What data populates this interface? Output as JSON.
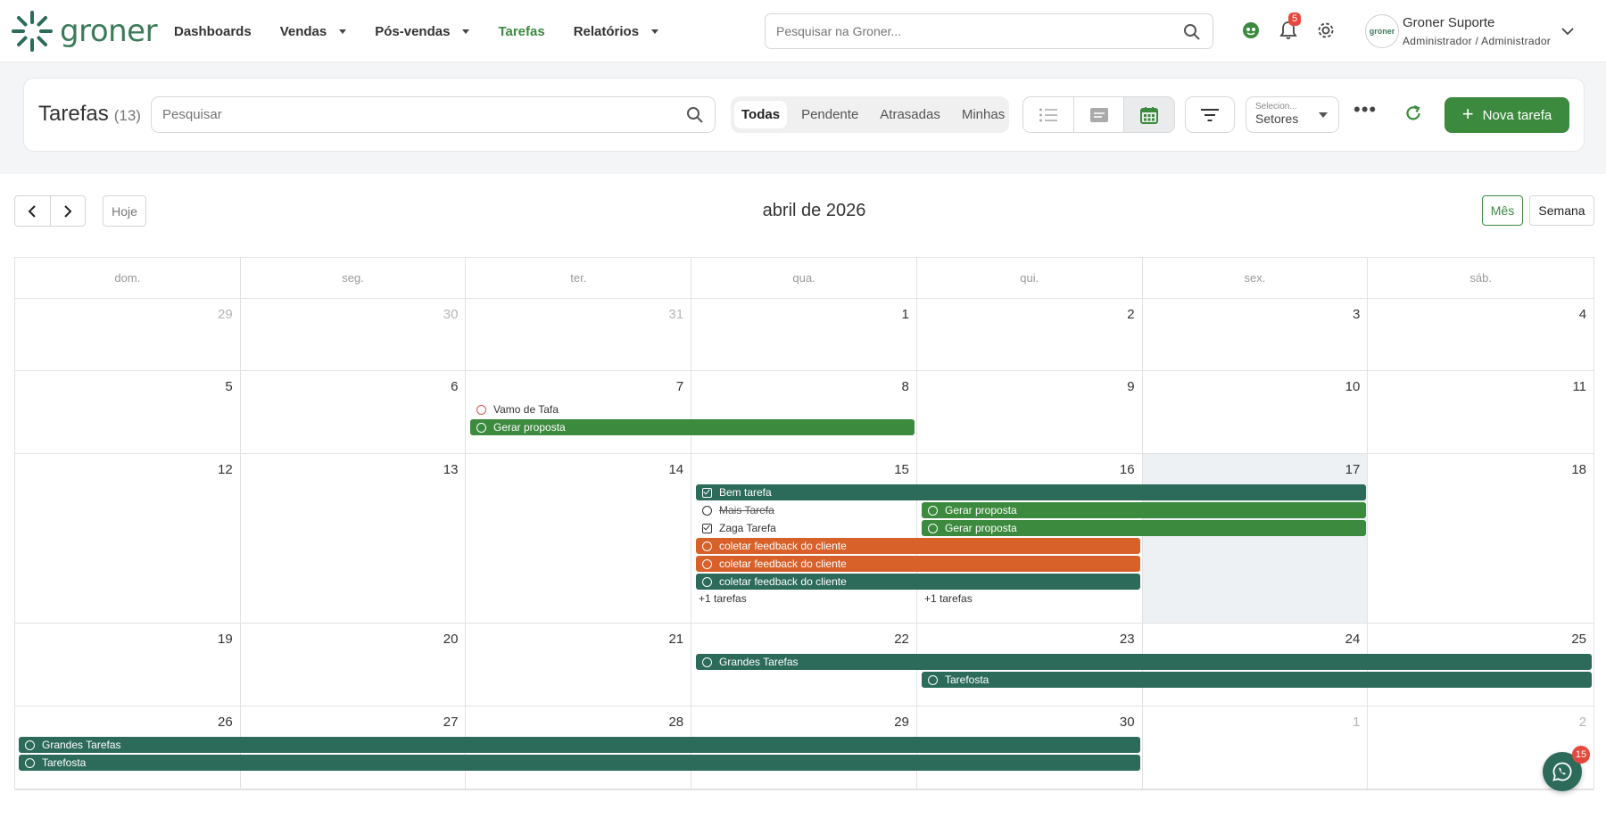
{
  "nav": {
    "brand": "groner",
    "links": [
      {
        "label": "Dashboards",
        "dropdown": false,
        "active": false
      },
      {
        "label": "Vendas",
        "dropdown": true,
        "active": false
      },
      {
        "label": "Pós-vendas",
        "dropdown": true,
        "active": false
      },
      {
        "label": "Tarefas",
        "dropdown": false,
        "active": true
      },
      {
        "label": "Relatórios",
        "dropdown": true,
        "active": false
      }
    ],
    "search_placeholder": "Pesquisar na Groner...",
    "notifications_count": "5",
    "user": {
      "name": "Groner Suporte",
      "role": "Administrador / Administrador",
      "avatar_text": "groner"
    }
  },
  "toolbar": {
    "title": "Tarefas",
    "count": "(13)",
    "search_placeholder": "Pesquisar",
    "filters": [
      "Todas",
      "Pendente",
      "Atrasadas",
      "Minhas"
    ],
    "active_filter": "Todas",
    "views": [
      "list-icon",
      "card-icon",
      "calendar-icon"
    ],
    "active_view": "calendar",
    "sector_hint": "Selecion...",
    "sector_value": "Setores",
    "new_task_label": "Nova tarefa"
  },
  "calendar": {
    "title": "abril de 2026",
    "today_label": "Hoje",
    "view_month": "Mês",
    "view_week": "Semana",
    "active_view": "Mês",
    "weekdays": [
      "dom.",
      "seg.",
      "ter.",
      "qua.",
      "qui.",
      "sex.",
      "sáb."
    ],
    "weeks": [
      [
        "29",
        "30",
        "31",
        "1",
        "2",
        "3",
        "4"
      ],
      [
        "5",
        "6",
        "7",
        "8",
        "9",
        "10",
        "11"
      ],
      [
        "12",
        "13",
        "14",
        "15",
        "16",
        "17",
        "18"
      ],
      [
        "19",
        "20",
        "21",
        "22",
        "23",
        "24",
        "25"
      ],
      [
        "26",
        "27",
        "28",
        "29",
        "30",
        "1",
        "2"
      ]
    ],
    "other_month_cells": [
      [
        0,
        0
      ],
      [
        0,
        1
      ],
      [
        0,
        2
      ],
      [
        4,
        5
      ],
      [
        4,
        6
      ]
    ],
    "today_cell": [
      2,
      5
    ],
    "events": [
      {
        "label": "Vamo de Tafa",
        "week": 1,
        "start": 2,
        "span": 1,
        "lane": 0,
        "style": "plain",
        "icon": "circle",
        "circle_color": "red"
      },
      {
        "label": "Gerar proposta",
        "week": 1,
        "start": 2,
        "span": 2,
        "lane": 1,
        "style": "green",
        "icon": "circle"
      },
      {
        "label": "Bem tarefa",
        "week": 2,
        "start": 3,
        "span": 3,
        "lane": 0,
        "style": "teal",
        "icon": "check"
      },
      {
        "label": "Mais Tarefa",
        "week": 2,
        "start": 3,
        "span": 1,
        "lane": 1,
        "style": "plain",
        "icon": "circle",
        "strike": true
      },
      {
        "label": "Gerar proposta",
        "week": 2,
        "start": 4,
        "span": 2,
        "lane": 1,
        "style": "green",
        "icon": "circle"
      },
      {
        "label": "Zaga Tarefa",
        "week": 2,
        "start": 3,
        "span": 1,
        "lane": 2,
        "style": "plain",
        "icon": "check"
      },
      {
        "label": "Gerar proposta",
        "week": 2,
        "start": 4,
        "span": 2,
        "lane": 2,
        "style": "green",
        "icon": "circle"
      },
      {
        "label": "coletar feedback do cliente",
        "week": 2,
        "start": 3,
        "span": 2,
        "lane": 3,
        "style": "orange",
        "icon": "circle"
      },
      {
        "label": "coletar feedback do cliente",
        "week": 2,
        "start": 3,
        "span": 2,
        "lane": 4,
        "style": "orange",
        "icon": "circle"
      },
      {
        "label": "coletar feedback do cliente",
        "week": 2,
        "start": 3,
        "span": 2,
        "lane": 5,
        "style": "teal",
        "icon": "circle"
      },
      {
        "label": "Grandes Tarefas",
        "week": 3,
        "start": 3,
        "span": 4,
        "lane": 0,
        "style": "teal",
        "icon": "circle"
      },
      {
        "label": "Tarefosta",
        "week": 3,
        "start": 4,
        "span": 3,
        "lane": 1,
        "style": "teal",
        "icon": "circle"
      },
      {
        "label": "Grandes Tarefas",
        "week": 4,
        "start": 0,
        "span": 5,
        "lane": 0,
        "style": "teal",
        "icon": "circle"
      },
      {
        "label": "Tarefosta",
        "week": 4,
        "start": 0,
        "span": 5,
        "lane": 1,
        "style": "teal",
        "icon": "circle"
      }
    ],
    "more_links": [
      {
        "label": "+1 tarefas",
        "week": 2,
        "col": 3
      },
      {
        "label": "+1 tarefas",
        "week": 2,
        "col": 4
      }
    ]
  },
  "chat": {
    "badge": "15"
  },
  "colors": {
    "brand_green": "#3c8a3e",
    "teal": "#2c6b5a",
    "orange": "#d8612a",
    "badge_red": "#e5483c"
  }
}
